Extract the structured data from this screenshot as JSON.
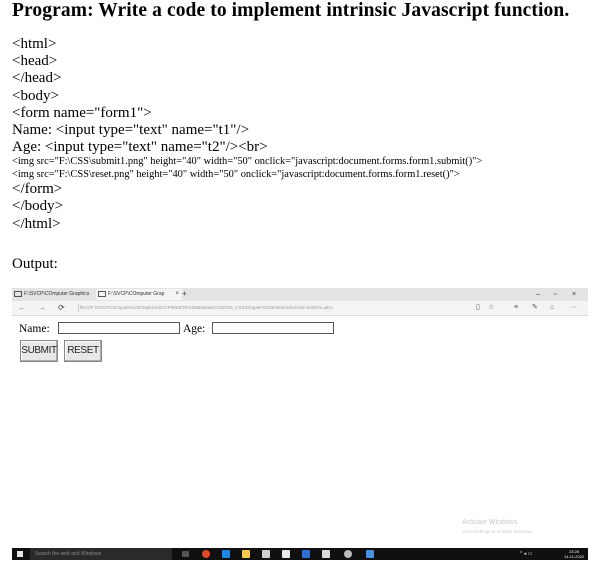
{
  "heading": "Program:  Write a code to implement intrinsic Javascript function.",
  "code_lines": [
    "<html>",
    "<head>",
    "</head>",
    "<body>",
    "<form name=\"form1\">",
    "Name: <input type=\"text\" name=\"t1\"/>",
    "Age: <input type=\"text\" name=\"t2\"/><br>",
    "<img src=\"F:\\CSS\\submit1.png\" height=\"40\" width=\"50\" onclick=\"javascript:document.forms.form1.submit()\">",
    "<img src=\"F:\\CSS\\reset.png\" height=\"40\" width=\"50\" onclick=\"javascript:document.forms.form1.reset()\">",
    "</form>",
    "</body>",
    "</html>"
  ],
  "output_label": "Output:",
  "browser": {
    "tabs": [
      {
        "label": "F:\\SVCP\\COmputer Graphics",
        "active": false
      },
      {
        "label": "F:\\SVCP\\COmputer Grap",
        "active": true
      }
    ],
    "new_tab": "+",
    "window_controls": [
      "–",
      "▫",
      "×"
    ],
    "nav": {
      "back": "←",
      "forward": "→",
      "refresh": "⟳"
    },
    "url": "file:///F:/SVCP/COmputer%20Graphics/SVCP/MSBTE%20Material/CSS/SS6_CSS/Chapter%203/intrinsicfunction.html#t1=&t2=",
    "page": {
      "name_label": "Name:",
      "age_label": "Age:",
      "name_value": "",
      "age_value": "",
      "submit_label": "SUBMIT",
      "reset_label": "RESET"
    },
    "watermark": {
      "title": "Activate Windows",
      "subtitle": "Go to Settings to activate Windows."
    },
    "taskbar": {
      "search_placeholder": "Search the web and Windows",
      "time": "23:28",
      "date": "14-11-2022"
    }
  }
}
